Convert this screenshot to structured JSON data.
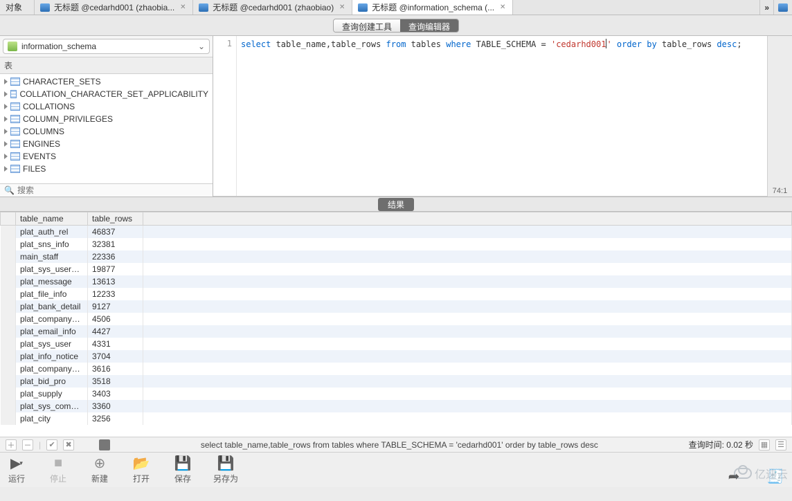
{
  "tabs": {
    "items": [
      {
        "label": "对象",
        "has_icon": false,
        "closable": false
      },
      {
        "label": "无标题 @cedarhd001 (zhaobia...",
        "has_icon": true,
        "closable": true
      },
      {
        "label": "无标题 @cedarhd001 (zhaobiao)",
        "has_icon": true,
        "closable": true
      },
      {
        "label": "无标题 @information_schema (...",
        "has_icon": true,
        "closable": true,
        "active": true
      }
    ],
    "overflow_glyph": "»"
  },
  "mode_toggle": {
    "builder": "查询创建工具",
    "editor": "查询编辑器"
  },
  "schema_selector": {
    "name": "information_schema"
  },
  "tree_header": "表",
  "tree_items": [
    "CHARACTER_SETS",
    "COLLATION_CHARACTER_SET_APPLICABILITY",
    "COLLATIONS",
    "COLUMN_PRIVILEGES",
    "COLUMNS",
    "ENGINES",
    "EVENTS",
    "FILES"
  ],
  "search_placeholder": "搜索",
  "editor": {
    "line_no": "1",
    "position_indicator": "74:1",
    "tokens": [
      {
        "t": "select ",
        "c": "kw"
      },
      {
        "t": "table_name,table_rows ",
        "c": "ident"
      },
      {
        "t": "from ",
        "c": "kw"
      },
      {
        "t": "tables ",
        "c": "ident"
      },
      {
        "t": "where ",
        "c": "kw"
      },
      {
        "t": "TABLE_SCHEMA = ",
        "c": "ident"
      },
      {
        "t": "'cedarhd001",
        "c": "str"
      },
      {
        "t": "",
        "c": "cursor"
      },
      {
        "t": "'",
        "c": "str"
      },
      {
        "t": " order by ",
        "c": "kw"
      },
      {
        "t": "table_rows ",
        "c": "ident"
      },
      {
        "t": "desc",
        "c": "kw"
      },
      {
        "t": ";",
        "c": "ident"
      }
    ]
  },
  "results": {
    "tab_label": "结果",
    "columns": [
      "table_name",
      "table_rows"
    ],
    "rows": [
      [
        "plat_auth_rel",
        "46837"
      ],
      [
        "plat_sns_info",
        "32381"
      ],
      [
        "main_staff",
        "22336"
      ],
      [
        "plat_sys_user_reco",
        "19877"
      ],
      [
        "plat_message",
        "13613"
      ],
      [
        "plat_file_info",
        "12233"
      ],
      [
        "plat_bank_detail",
        "9127"
      ],
      [
        "plat_company_ach",
        "4506"
      ],
      [
        "plat_email_info",
        "4427"
      ],
      [
        "plat_sys_user",
        "4331"
      ],
      [
        "plat_info_notice",
        "3704"
      ],
      [
        "plat_company_atta",
        "3616"
      ],
      [
        "plat_bid_pro",
        "3518"
      ],
      [
        "plat_supply",
        "3403"
      ],
      [
        "plat_sys_company",
        "3360"
      ],
      [
        "plat_city",
        "3256"
      ]
    ]
  },
  "footer": {
    "sql_echo": "select table_name,table_rows from tables where TABLE_SCHEMA = 'cedarhd001' order by table_rows desc",
    "timing": "查询时间: 0.02 秒"
  },
  "toolbar": {
    "run": "运行",
    "stop": "停止",
    "new": "新建",
    "open": "打开",
    "save": "保存",
    "save_as": "另存为"
  },
  "watermark": "亿速云"
}
